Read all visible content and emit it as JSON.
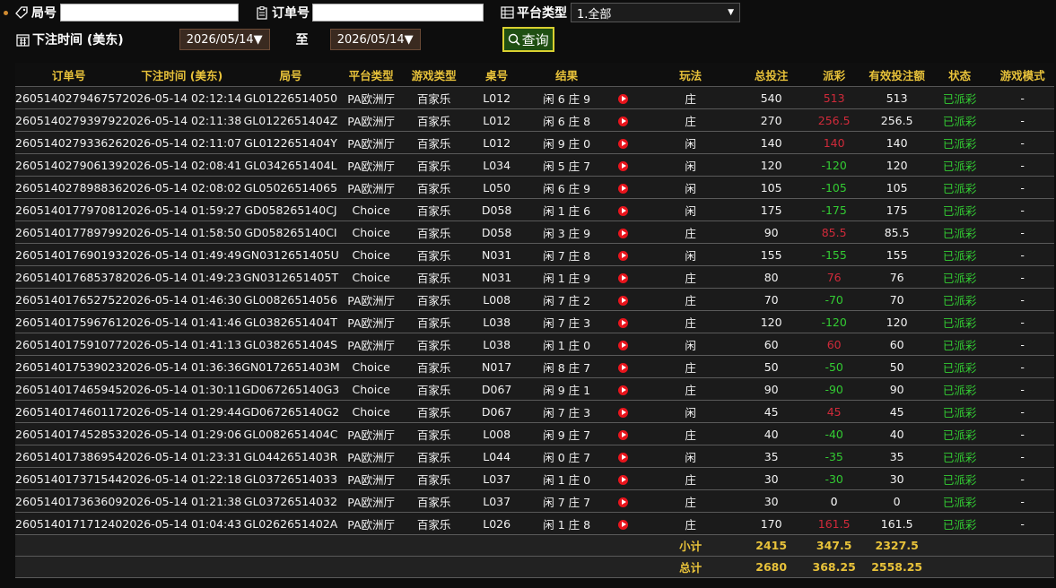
{
  "filters": {
    "round_label": "局号",
    "round_value": "",
    "order_label": "订单号",
    "order_value": "",
    "platform_label": "平台类型",
    "platform_selected": "1.全部",
    "bet_time_label": "下注时间 (美东)",
    "date_from": "2026/05/14▼",
    "to_label": "至",
    "date_to": "2026/05/14▼",
    "query_label": "查询"
  },
  "columns": [
    "订单号",
    "下注时间 (美东)",
    "局号",
    "平台类型",
    "游戏类型",
    "桌号",
    "结果",
    "",
    "玩法",
    "总投注",
    "派彩",
    "有效投注额",
    "状态",
    "游戏模式"
  ],
  "rows": [
    [
      "260514027946757",
      "2026-05-14 02:12:14",
      "GL01226514050",
      "PA欧洲厅",
      "百家乐",
      "L012",
      "闲 6 庄 9",
      "庄",
      "540",
      "513",
      "513",
      "已派彩",
      "-"
    ],
    [
      "260514027939792",
      "2026-05-14 02:11:38",
      "GL0122651404Z",
      "PA欧洲厅",
      "百家乐",
      "L012",
      "闲 6 庄 8",
      "庄",
      "270",
      "256.5",
      "256.5",
      "已派彩",
      "-"
    ],
    [
      "260514027933626",
      "2026-05-14 02:11:07",
      "GL0122651404Y",
      "PA欧洲厅",
      "百家乐",
      "L012",
      "闲 9 庄 0",
      "闲",
      "140",
      "140",
      "140",
      "已派彩",
      "-"
    ],
    [
      "260514027906139",
      "2026-05-14 02:08:41",
      "GL0342651404L",
      "PA欧洲厅",
      "百家乐",
      "L034",
      "闲 5 庄 7",
      "闲",
      "120",
      "-120",
      "120",
      "已派彩",
      "-"
    ],
    [
      "260514027898836",
      "2026-05-14 02:08:02",
      "GL05026514065",
      "PA欧洲厅",
      "百家乐",
      "L050",
      "闲 6 庄 9",
      "闲",
      "105",
      "-105",
      "105",
      "已派彩",
      "-"
    ],
    [
      "260514017797081",
      "2026-05-14 01:59:27",
      "GD058265140CJ",
      "Choice",
      "百家乐",
      "D058",
      "闲 1 庄 6",
      "闲",
      "175",
      "-175",
      "175",
      "已派彩",
      "-"
    ],
    [
      "260514017789799",
      "2026-05-14 01:58:50",
      "GD058265140CI",
      "Choice",
      "百家乐",
      "D058",
      "闲 3 庄 9",
      "庄",
      "90",
      "85.5",
      "85.5",
      "已派彩",
      "-"
    ],
    [
      "260514017690193",
      "2026-05-14 01:49:49",
      "GN0312651405U",
      "Choice",
      "百家乐",
      "N031",
      "闲 7 庄 8",
      "闲",
      "155",
      "-155",
      "155",
      "已派彩",
      "-"
    ],
    [
      "260514017685378",
      "2026-05-14 01:49:23",
      "GN0312651405T",
      "Choice",
      "百家乐",
      "N031",
      "闲 1 庄 9",
      "庄",
      "80",
      "76",
      "76",
      "已派彩",
      "-"
    ],
    [
      "260514017652752",
      "2026-05-14 01:46:30",
      "GL00826514056",
      "PA欧洲厅",
      "百家乐",
      "L008",
      "闲 7 庄 2",
      "庄",
      "70",
      "-70",
      "70",
      "已派彩",
      "-"
    ],
    [
      "260514017596761",
      "2026-05-14 01:41:46",
      "GL0382651404T",
      "PA欧洲厅",
      "百家乐",
      "L038",
      "闲 7 庄 3",
      "庄",
      "120",
      "-120",
      "120",
      "已派彩",
      "-"
    ],
    [
      "260514017591077",
      "2026-05-14 01:41:13",
      "GL0382651404S",
      "PA欧洲厅",
      "百家乐",
      "L038",
      "闲 1 庄 0",
      "闲",
      "60",
      "60",
      "60",
      "已派彩",
      "-"
    ],
    [
      "260514017539023",
      "2026-05-14 01:36:36",
      "GN0172651403M",
      "Choice",
      "百家乐",
      "N017",
      "闲 8 庄 7",
      "庄",
      "50",
      "-50",
      "50",
      "已派彩",
      "-"
    ],
    [
      "260514017465945",
      "2026-05-14 01:30:11",
      "GD067265140G3",
      "Choice",
      "百家乐",
      "D067",
      "闲 9 庄 1",
      "庄",
      "90",
      "-90",
      "90",
      "已派彩",
      "-"
    ],
    [
      "260514017460117",
      "2026-05-14 01:29:44",
      "GD067265140G2",
      "Choice",
      "百家乐",
      "D067",
      "闲 7 庄 3",
      "闲",
      "45",
      "45",
      "45",
      "已派彩",
      "-"
    ],
    [
      "260514017452853",
      "2026-05-14 01:29:06",
      "GL0082651404C",
      "PA欧洲厅",
      "百家乐",
      "L008",
      "闲 9 庄 7",
      "庄",
      "40",
      "-40",
      "40",
      "已派彩",
      "-"
    ],
    [
      "260514017386954",
      "2026-05-14 01:23:31",
      "GL0442651403R",
      "PA欧洲厅",
      "百家乐",
      "L044",
      "闲 0 庄 7",
      "闲",
      "35",
      "-35",
      "35",
      "已派彩",
      "-"
    ],
    [
      "260514017371544",
      "2026-05-14 01:22:18",
      "GL03726514033",
      "PA欧洲厅",
      "百家乐",
      "L037",
      "闲 1 庄 0",
      "庄",
      "30",
      "-30",
      "30",
      "已派彩",
      "-"
    ],
    [
      "260514017363609",
      "2026-05-14 01:21:38",
      "GL03726514032",
      "PA欧洲厅",
      "百家乐",
      "L037",
      "闲 7 庄 7",
      "庄",
      "30",
      "0",
      "0",
      "已派彩",
      "-"
    ],
    [
      "260514017171240",
      "2026-05-14 01:04:43",
      "GL0262651402A",
      "PA欧洲厅",
      "百家乐",
      "L026",
      "闲 1 庄 8",
      "庄",
      "170",
      "161.5",
      "161.5",
      "已派彩",
      "-"
    ]
  ],
  "subtotal": {
    "label": "小计",
    "total_bet": "2415",
    "payout": "347.5",
    "valid_bet": "2327.5"
  },
  "total": {
    "label": "总计",
    "total_bet": "2680",
    "payout": "368.25",
    "valid_bet": "2558.25"
  },
  "colors": {
    "win": "#33cc33",
    "lose": "#d02a3a",
    "header_text": "#e8c23a"
  },
  "icons": {
    "round": "tag-icon",
    "order": "clipboard-icon",
    "platform": "list-icon",
    "time": "calendar-icon",
    "query": "search-icon",
    "replay": "play-icon"
  }
}
